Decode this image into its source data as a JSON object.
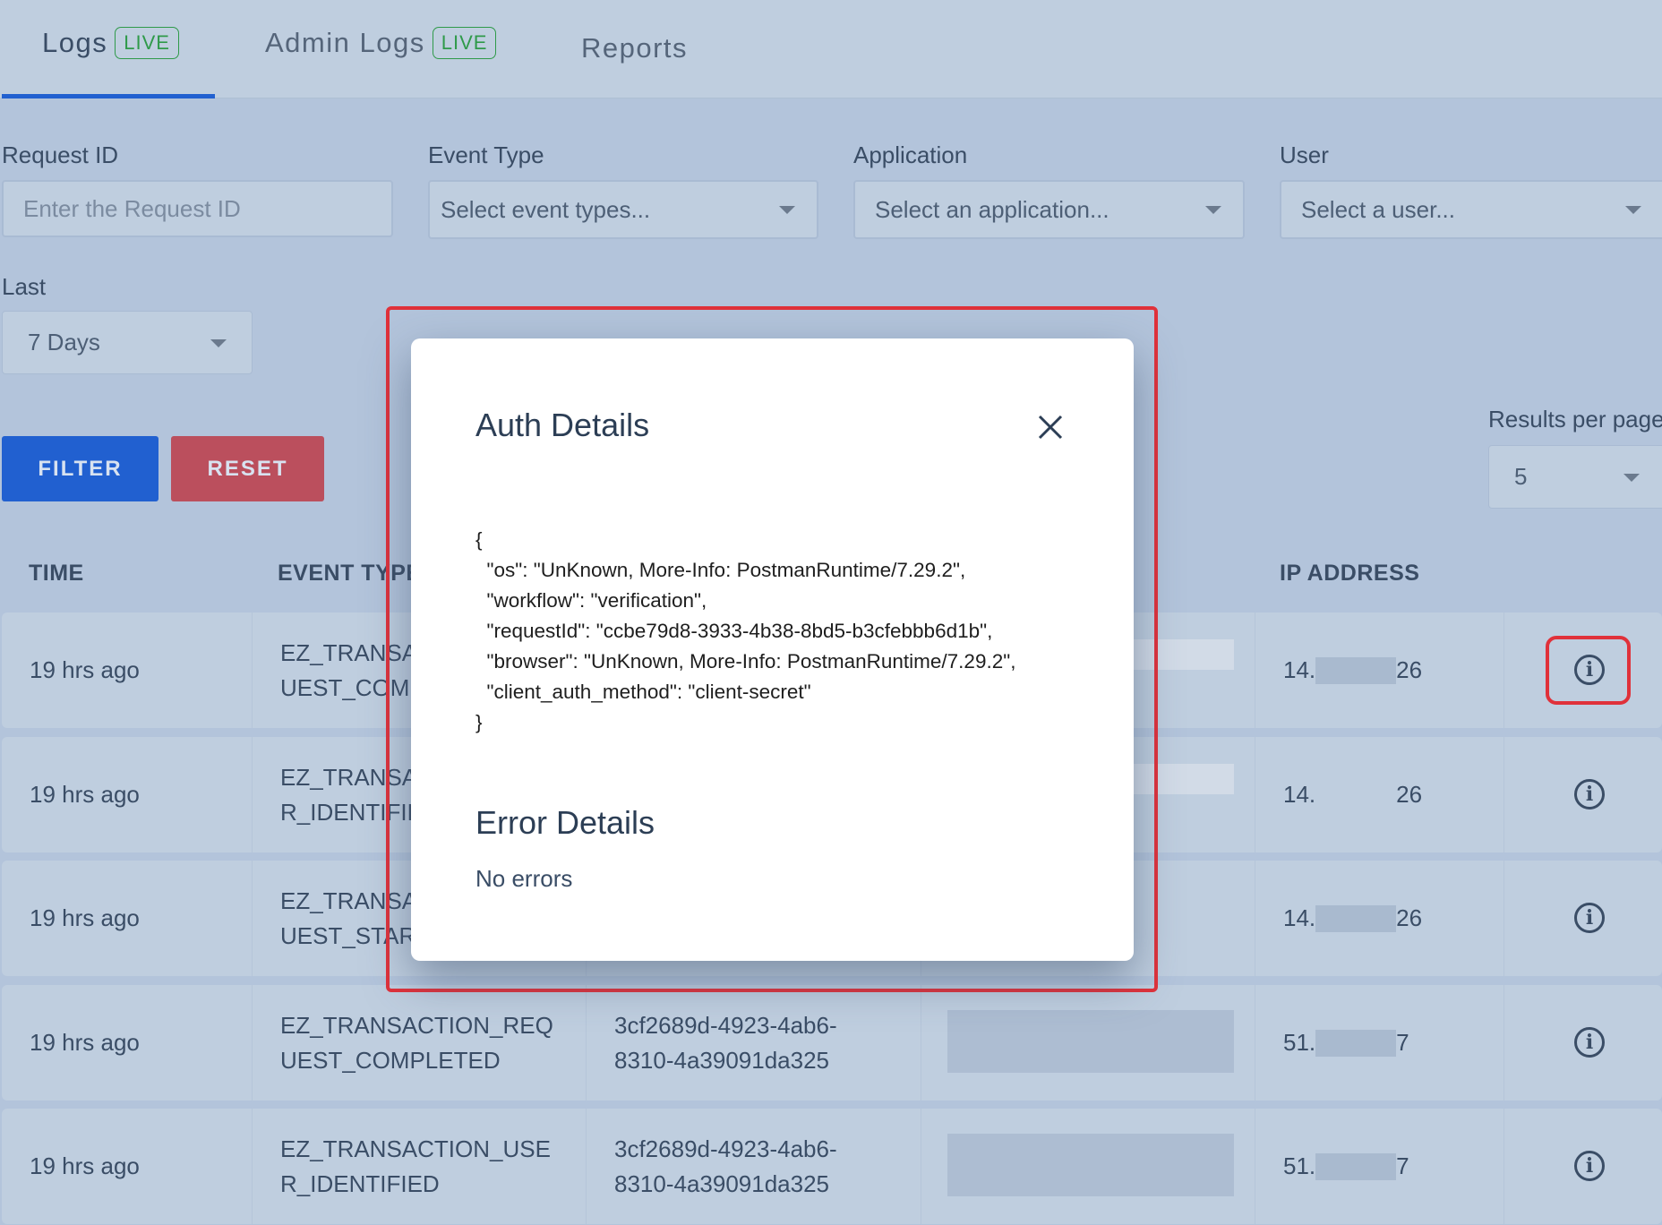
{
  "tabs": [
    {
      "label": "Logs",
      "badge": "LIVE",
      "active": true
    },
    {
      "label": "Admin Logs",
      "badge": "LIVE"
    },
    {
      "label": "Reports"
    }
  ],
  "filters": {
    "request_id": {
      "label": "Request ID",
      "placeholder": "Enter the Request ID"
    },
    "event_type": {
      "label": "Event Type",
      "placeholder": "Select event types..."
    },
    "application": {
      "label": "Application",
      "placeholder": "Select an application..."
    },
    "user": {
      "label": "User",
      "placeholder": "Select a user..."
    },
    "last": {
      "label": "Last",
      "value": "7 Days"
    },
    "filter_label": "FILTER",
    "reset_label": "RESET",
    "results_per_page": {
      "label": "Results per page",
      "value": "5"
    }
  },
  "table": {
    "headers": {
      "time": "TIME",
      "event_type": "EVENT TYPE",
      "ip": "IP ADDRESS"
    },
    "rows": [
      {
        "time": "19 hrs ago",
        "event": [
          "EZ_TRANSA",
          "UEST_COMI"
        ],
        "request": [
          "",
          ""
        ],
        "ip_start": "14.",
        "ip_end": "26"
      },
      {
        "time": "19 hrs ago",
        "event": [
          "EZ_TRANSA",
          "R_IDENTIFIE"
        ],
        "request": [
          "",
          ""
        ],
        "ip_start": "14.",
        "ip_end": "26"
      },
      {
        "time": "19 hrs ago",
        "event": [
          "EZ_TRANSA",
          "UEST_STAR"
        ],
        "request": [
          "",
          ""
        ],
        "ip_start": "14.",
        "ip_end": "26"
      },
      {
        "time": "19 hrs ago",
        "event": [
          "EZ_TRANSACTION_REQ",
          "UEST_COMPLETED"
        ],
        "request": [
          "3cf2689d-4923-4ab6-",
          "8310-4a39091da325"
        ],
        "ip_start": "51.",
        "ip_end": "7"
      },
      {
        "time": "19 hrs ago",
        "event": [
          "EZ_TRANSACTION_USE",
          "R_IDENTIFIED"
        ],
        "request": [
          "3cf2689d-4923-4ab6-",
          "8310-4a39091da325"
        ],
        "ip_start": "51.",
        "ip_end": "7"
      }
    ]
  },
  "modal": {
    "title": "Auth Details",
    "json": "{\n  \"os\": \"UnKnown, More-Info: PostmanRuntime/7.29.2\",\n  \"workflow\": \"verification\",\n  \"requestId\": \"ccbe79d8-3933-4b38-8bd5-b3cfebbb6d1b\",\n  \"browser\": \"UnKnown, More-Info: PostmanRuntime/7.29.2\",\n  \"client_auth_method\": \"client-secret\"\n}",
    "error_title": "Error Details",
    "error_text": "No errors"
  },
  "colors": {
    "accent": "#2160d0",
    "reset": "#bb4f5d",
    "live": "#2f9a4a",
    "highlight": "#e0313a"
  }
}
